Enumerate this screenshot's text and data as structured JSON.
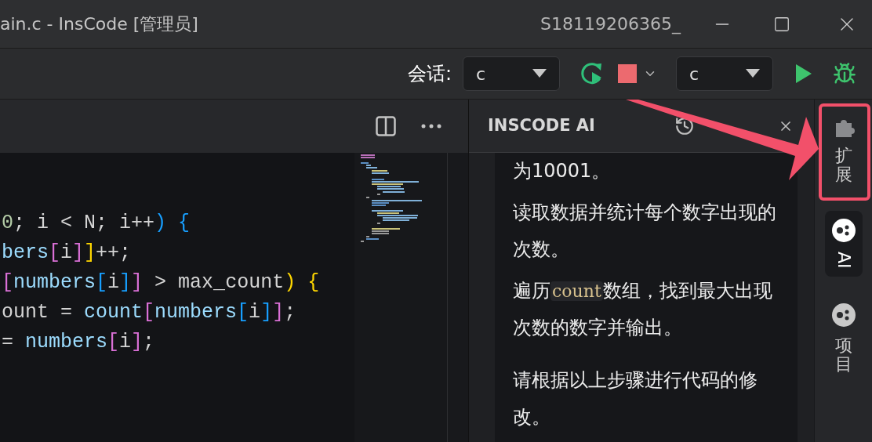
{
  "title_bar": {
    "title": "ain.c - InsCode [管理员]",
    "user": "S18119206365_"
  },
  "toolbar": {
    "session_label": "会话:",
    "session_select": {
      "value": "c"
    },
    "run_select": {
      "value": "c"
    }
  },
  "editor": {
    "lines": [
      {
        "tokens": [
          {
            "text": "0",
            "color": "#b5cea8"
          },
          {
            "text": "; i < N; i++",
            "color": "#d4d4d4"
          },
          {
            "text": ")",
            "color": "#179fff"
          },
          {
            "text": " {",
            "color": "#179fff"
          }
        ]
      },
      {
        "tokens": [
          {
            "text": "bers",
            "color": "#9cdcfe"
          },
          {
            "text": "[",
            "color": "#da70d6"
          },
          {
            "text": "i",
            "color": "#d4d4d4"
          },
          {
            "text": "]",
            "color": "#da70d6"
          },
          {
            "text": "]",
            "color": "#ffd700"
          },
          {
            "text": "++;",
            "color": "#d4d4d4"
          }
        ]
      },
      {
        "tokens": [
          {
            "text": "[",
            "color": "#da70d6"
          },
          {
            "text": "numbers",
            "color": "#9cdcfe"
          },
          {
            "text": "[",
            "color": "#179fff"
          },
          {
            "text": "i",
            "color": "#d4d4d4"
          },
          {
            "text": "]",
            "color": "#179fff"
          },
          {
            "text": "]",
            "color": "#da70d6"
          },
          {
            "text": " > max_count",
            "color": "#d4d4d4"
          },
          {
            "text": ")",
            "color": "#ffd700"
          },
          {
            "text": " {",
            "color": "#ffd700"
          }
        ]
      },
      {
        "tokens": [
          {
            "text": "ount = ",
            "color": "#d4d4d4"
          },
          {
            "text": "count",
            "color": "#9cdcfe"
          },
          {
            "text": "[",
            "color": "#da70d6"
          },
          {
            "text": "numbers",
            "color": "#9cdcfe"
          },
          {
            "text": "[",
            "color": "#179fff"
          },
          {
            "text": "i",
            "color": "#d4d4d4"
          },
          {
            "text": "]",
            "color": "#179fff"
          },
          {
            "text": "]",
            "color": "#da70d6"
          },
          {
            "text": ";",
            "color": "#d4d4d4"
          }
        ]
      },
      {
        "tokens": [
          {
            "text": "= ",
            "color": "#d4d4d4"
          },
          {
            "text": "numbers",
            "color": "#9cdcfe"
          },
          {
            "text": "[",
            "color": "#da70d6"
          },
          {
            "text": "i",
            "color": "#d4d4d4"
          },
          {
            "text": "]",
            "color": "#da70d6"
          },
          {
            "text": ";",
            "color": "#d4d4d4"
          }
        ]
      }
    ]
  },
  "ai_panel": {
    "title": "INSCODE AI",
    "paragraphs": [
      {
        "segments": [
          {
            "kind": "text",
            "text": "为10001。"
          }
        ]
      },
      {
        "segments": [
          {
            "kind": "text",
            "text": "读取数据并统计每个数字出现的次数。"
          }
        ]
      },
      {
        "segments": [
          {
            "kind": "text",
            "text": "遍历"
          },
          {
            "kind": "code",
            "text": "count"
          },
          {
            "kind": "text",
            "text": "数组，找到最大出现次数的数字并输出。"
          }
        ]
      },
      {
        "segments": [
          {
            "kind": "text",
            "text": "请根据以上步骤进行代码的修改。"
          }
        ]
      }
    ]
  },
  "activity_bar": {
    "items": [
      {
        "label": "扩展",
        "kind": "extension",
        "selected": false
      },
      {
        "label": "AI",
        "kind": "assistant",
        "selected": true
      },
      {
        "label": "项目",
        "kind": "project",
        "selected": false
      }
    ]
  }
}
